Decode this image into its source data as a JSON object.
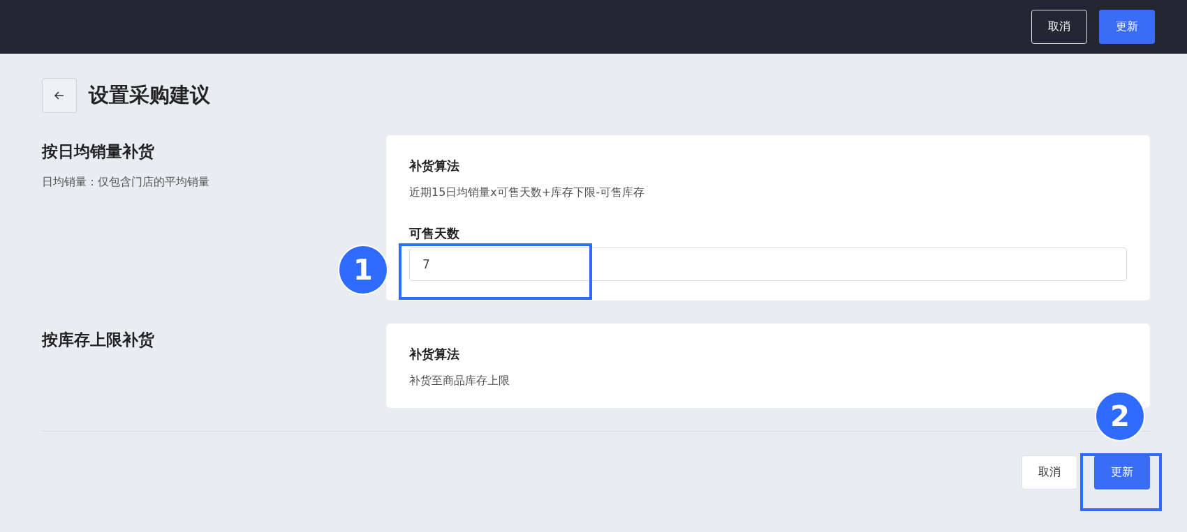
{
  "top_bar": {
    "buttons": [
      {
        "label": "取消",
        "kind": "secondary"
      },
      {
        "label": "更新",
        "kind": "primary"
      }
    ]
  },
  "page": {
    "title": "设置采购建议"
  },
  "sections": [
    {
      "title": "按日均销量补货",
      "subtitle": "日均销量：仅包含门店的平均销量",
      "card": {
        "heading": "补货算法",
        "text": "近期15日均销量x可售天数+库存下限-可售库存",
        "field": {
          "label": "可售天数",
          "value": "7"
        }
      }
    },
    {
      "title": "按库存上限补货",
      "card": {
        "heading": "补货算法",
        "text": "补货至商品库存上限"
      }
    }
  ],
  "footer": {
    "buttons": [
      {
        "label": "取消",
        "kind": "secondary"
      },
      {
        "label": "更新",
        "kind": "primary"
      }
    ]
  },
  "annotations": [
    {
      "label": "1"
    },
    {
      "label": "2"
    }
  ]
}
